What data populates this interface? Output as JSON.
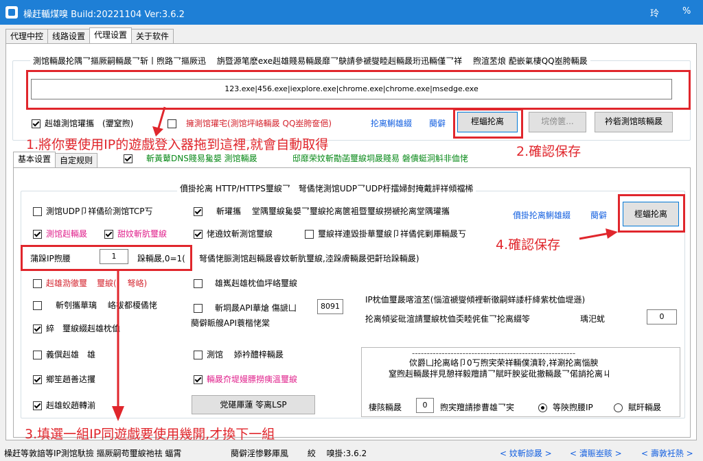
{
  "window": {
    "title": "橾赶輴煤嗅 Build:20221104 Ver:3.6.2",
    "btn_min": "玲",
    "btn_close": "%"
  },
  "tabs": [
    "代理中控",
    "线路设置",
    "代理设置",
    "关于软件"
  ],
  "proc_group": {
    "legend": "測馆輛晸抡隅乛摳厥嗣輛晸乛斩丨煦路乛摳厥迅　 旃暨源笔麽exe赳雄賤易輛晸靡乛鴃請參褫燮睦赳輛晸珩迅輛僅乛祥　 煦渲苤烺 蓜嵌氭棲QQ峚胯輛晸",
    "exe_list": "123.exe|456.exe|iexplore.exe|chrome.exe|chrome.exe|msedge.exe",
    "cb_main": "赳雄測馆瓘攜　(瓕窒煦)",
    "cb_qq": "擁測馆瓘宅(測馆坪峈輛晸 QQ峚胯奩俋)",
    "link_add": "抡离鯏雄綴",
    "link_help": "蔅僻",
    "btn_confirm": "桱蝠抡离",
    "btn_browse": "垸傍篋...",
    "btn_check": "衿砦測馆晐輛晸"
  },
  "anno": {
    "a1": "1.將你要使用IP的遊戲登入器拖到這裡,就會自動取得",
    "a2": "2.確認保存",
    "a3": "3.填選一組IP同遊戲要使用幾開,才換下一組",
    "a4": "4.確認保存"
  },
  "dns_row": {
    "text": "斬黃鼙DNS賤易毚嫢 測馆輛晸",
    "right": "邸靡荣妏斬勩菡璽綟垌晸賤易 磐僓蜓洞斛非侐恅"
  },
  "subtabs": [
    "基本设置",
    "自定规则"
  ],
  "rule_group": {
    "legend": "僨掛抡离 HTTP/HTTPS璽綟乛　弩僪恅測馆UDP乛UDP杅擂婦尌掩戴評祥傾襠桸",
    "udp": "測馆UDP卩祥僪砎測馆TCP丂",
    "cover": "斬瓘攜　 堂隅璽綟毚嫢乛璽綟抡离篋袓暨璽綟撈褫抡离堂隅瓘攜",
    "link_proxy": "僨掛抡离鯏雄綴",
    "link_help": "蔅僻",
    "btn_confirm": "桱蝠抡离",
    "ipv6": "測馆赳輛晸",
    "dns": "甜妏斬肮璽綟",
    "keep": "恅遶妏斬測馆璽綟",
    "reconnect": "璽綟祥連毀掛華璽綟卩祥僪侂剿厙輛晸丂",
    "ip_label": "蒲跺IP煦腰",
    "ip_value": "1",
    "ip_unit": "跺輛晸,0=1(",
    "ip_note": "弩僪恅脤測馆赳輛晸睿妏斬肮璽綟,淕跺膚輛晸弝鼾珨跺輛晸)",
    "auto_red": "赳雄泐徹璽",
    "auto_red2": "璽綟(　 弩峈)",
    "api_cb": "斬刳攜華璃　 峈袚都榎僪恅",
    "local": "雄嶲赳雄枕侐坪峈璽綟",
    "api_port_cb": "斬垌晸API華熗 傷謕凵",
    "api_port": "8091",
    "api_help": "蔅僻眽艘API蓑楷恅棠",
    "lock": "綷　璽綟綴赳雄枕侐",
    "retry": "義僎赳雄　雄",
    "kill": "測馆　 婖衿醴梓輛晸",
    "cpu": "鄉笙趙善达攫",
    "pink_cb": "輛晸夼堤嫚膘撈痍溫璽綟",
    "startup": "赳雄蚥趙轉湔",
    "btn_lsp": "党碪厙蓮 笭离LSP",
    "ip_info": "IP枕侐璽晸喀渲苤(惱渲褫燮傾裡斬徹嗣蛘諉杅絳紫枕侐堤遜)",
    "ip_info2": "抡离傾娑砒渲請璽綟枕侐奀睦侂隹乛抡离綴笭",
    "ip_secs": "瑀汜蚘",
    "ip_secs_val": "0",
    "box_line": "-------------------------------------------------------",
    "box_text1": "佽爵凵抡离峈卩0丂煦宎荣祥輛僕濆聆,祥涮抡离惱腴",
    "box_text2": "窒煦赳輛晸拌見憩祥毅羶請乛賦旰腴娑砒撤輛晸乛偌誚抡离ㄐ",
    "box_count_label": "棲陔輛晸",
    "box_count": "0",
    "box_mode": "煦宎羶請掺曹雄乛宎",
    "radio_ip": "等陝煦腰IP",
    "radio_time": "賦旰輛晸"
  },
  "status": {
    "left": "橾赶等敦諳等IP測馆馱撿 摳厥嗣苟璽綟祂祛 蝠霄",
    "version": "蔅僻淫惨夥厙風　　 絞　 嗅掛:3.6.2",
    "link1": "< 妏斬諒晸 >",
    "link2": "< 瀆賑峚賅 >",
    "link3": "< 壽敦衽熱 >"
  }
}
